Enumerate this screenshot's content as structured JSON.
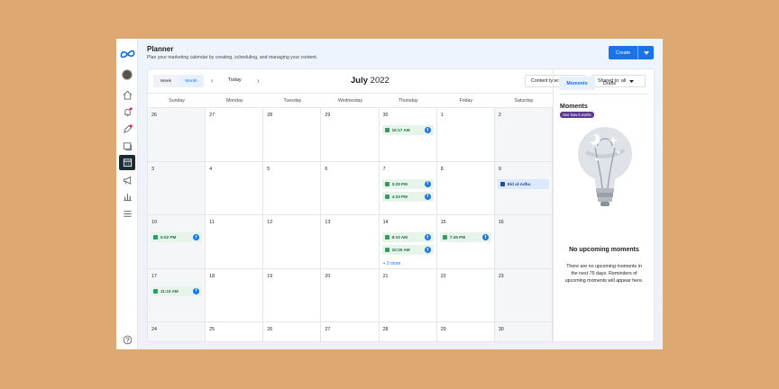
{
  "header": {
    "title": "Planner",
    "subtitle": "Plan your marketing calendar by creating, scheduling, and managing your content.",
    "create_label": "Create"
  },
  "toolbar": {
    "week_label": "Week",
    "month_label": "Month",
    "prev": "‹",
    "next": "›",
    "today_label": "Today",
    "month_name": "July",
    "year": "2022",
    "content_filter": "Content type: all",
    "shared_filter": "Shared to: all"
  },
  "weekdays": [
    "Sunday",
    "Monday",
    "Tuesday",
    "Wednesday",
    "Thursday",
    "Friday",
    "Saturday"
  ],
  "days": [
    {
      "n": "26",
      "out": true
    },
    {
      "n": "27"
    },
    {
      "n": "28"
    },
    {
      "n": "29"
    },
    {
      "n": "30",
      "events": [
        "10:17 AM"
      ]
    },
    {
      "n": "1"
    },
    {
      "n": "2",
      "out": true
    },
    {
      "n": "3",
      "out": true
    },
    {
      "n": "4"
    },
    {
      "n": "5"
    },
    {
      "n": "6"
    },
    {
      "n": "7",
      "events": [
        "3:29 PM",
        "4:33 PM"
      ]
    },
    {
      "n": "8"
    },
    {
      "n": "9",
      "out": true,
      "holiday": "Eid al-Adha"
    },
    {
      "n": "10",
      "out": true,
      "events": [
        "5:02 PM"
      ]
    },
    {
      "n": "11"
    },
    {
      "n": "12"
    },
    {
      "n": "13"
    },
    {
      "n": "14",
      "events": [
        "8:10 AM",
        "10:25 AM"
      ],
      "more": "+ 2 more"
    },
    {
      "n": "15",
      "events": [
        "7:45 PM"
      ]
    },
    {
      "n": "16",
      "out": true
    },
    {
      "n": "17",
      "out": true,
      "events": [
        "11:10 AM"
      ]
    },
    {
      "n": "18"
    },
    {
      "n": "19"
    },
    {
      "n": "20"
    },
    {
      "n": "21"
    },
    {
      "n": "22"
    },
    {
      "n": "23",
      "out": true
    },
    {
      "n": "24",
      "out": true
    },
    {
      "n": "25"
    },
    {
      "n": "26"
    },
    {
      "n": "27"
    },
    {
      "n": "28"
    },
    {
      "n": "29"
    },
    {
      "n": "30",
      "out": true
    }
  ],
  "side": {
    "tab_moments": "Moments",
    "tab_drafts": "Drafts",
    "moments_title": "Moments",
    "see_how": "See how it works",
    "empty_title": "No upcoming moments",
    "empty_text": "There are no upcoming moments in the next 75 days. Reminders of upcoming moments will appear here."
  },
  "colors": {
    "accent": "#1a73e8",
    "event_bg": "#e6f4ea",
    "facebook": "#1877f2",
    "badge": "#5b3a8e"
  },
  "rail_icons": [
    "meta-logo-icon",
    "avatar",
    "home-icon",
    "notification-icon",
    "activity-icon",
    "posts-icon",
    "planner-icon",
    "ads-icon",
    "insights-icon",
    "menu-icon",
    "help-icon"
  ]
}
